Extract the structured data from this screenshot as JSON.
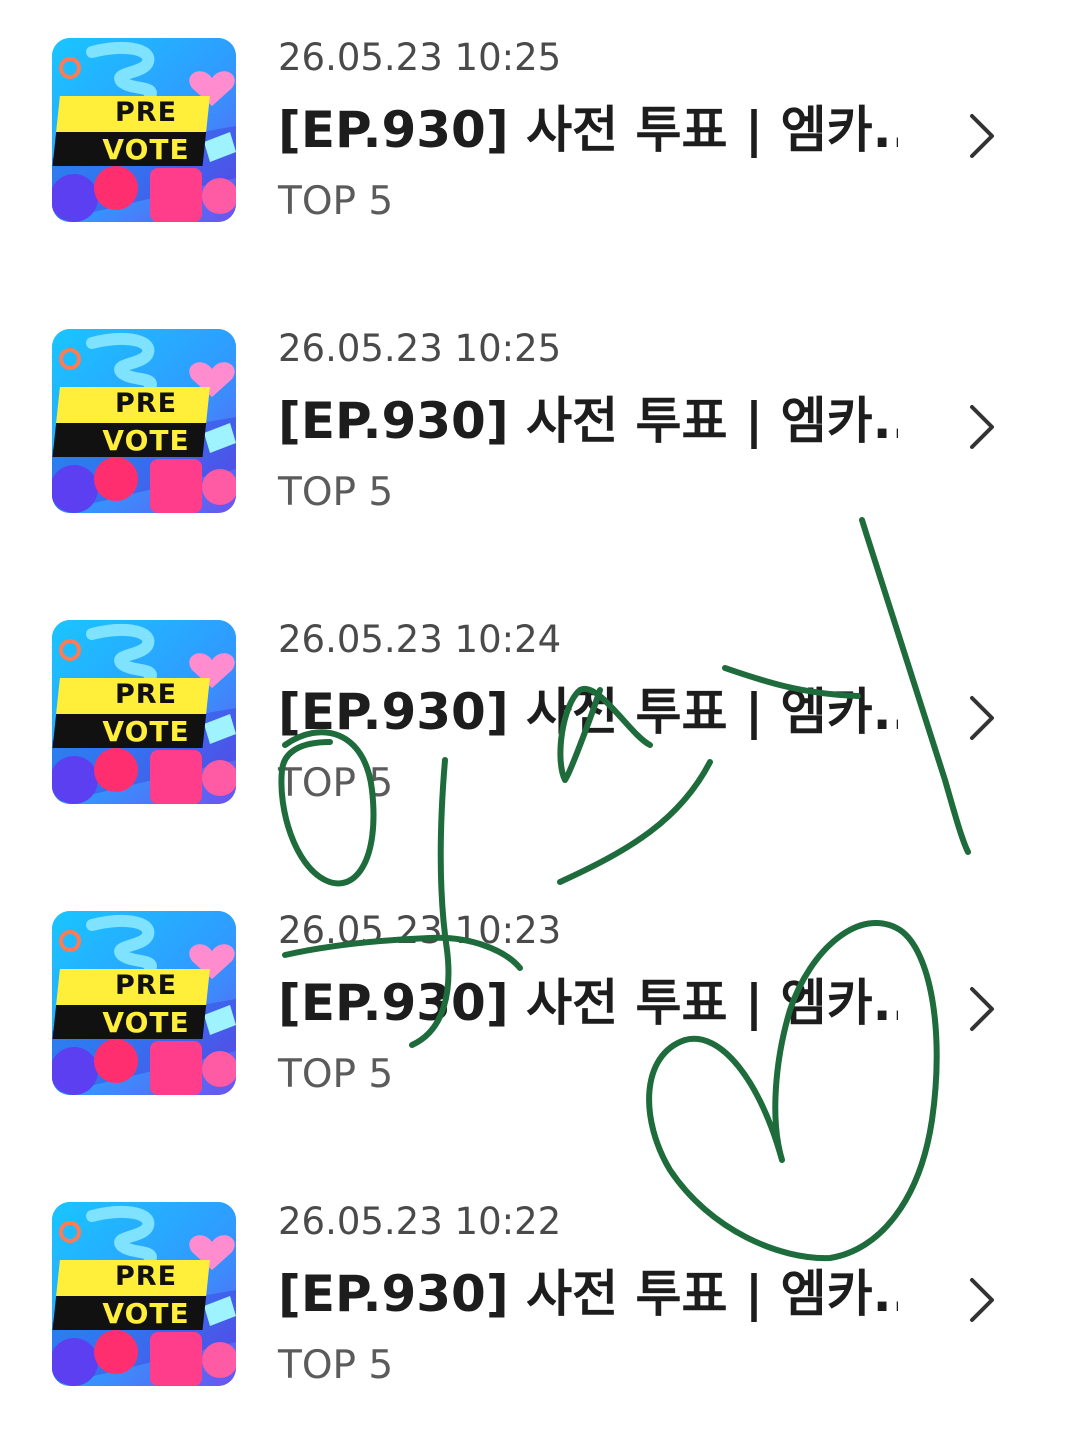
{
  "items": [
    {
      "date": "26.05.23 10:25",
      "title": "[EP.930] 사전 투표 | 엠카...",
      "subtitle": "TOP 5",
      "badge_line1": "PRE",
      "badge_line2": "VOTE"
    },
    {
      "date": "26.05.23 10:25",
      "title": "[EP.930] 사전 투표 | 엠카...",
      "subtitle": "TOP 5",
      "badge_line1": "PRE",
      "badge_line2": "VOTE"
    },
    {
      "date": "26.05.23 10:24",
      "title": "[EP.930] 사전 투표 | 엠카...",
      "subtitle": "TOP 5",
      "badge_line1": "PRE",
      "badge_line2": "VOTE"
    },
    {
      "date": "26.05.23 10:23",
      "title": "[EP.930] 사전 투표 | 엠카...",
      "subtitle": "TOP 5",
      "badge_line1": "PRE",
      "badge_line2": "VOTE"
    },
    {
      "date": "26.05.23 10:22",
      "title": "[EP.930] 사전 투표 | 엠카...",
      "subtitle": "TOP 5",
      "badge_line1": "PRE",
      "badge_line2": "VOTE"
    }
  ],
  "icons": {
    "row_chevron": "chevron-right-icon",
    "thumbnail": "pre-vote-thumbnail"
  },
  "colors": {
    "background": "#ffffff",
    "title_text": "#1d1d1d",
    "date_text": "#4a4a4a",
    "subtitle_text": "#5b5b5b",
    "chevron": "#333333",
    "badge_yellow": "#ffee3a",
    "scribble_ink": "#1e6b3c"
  }
}
